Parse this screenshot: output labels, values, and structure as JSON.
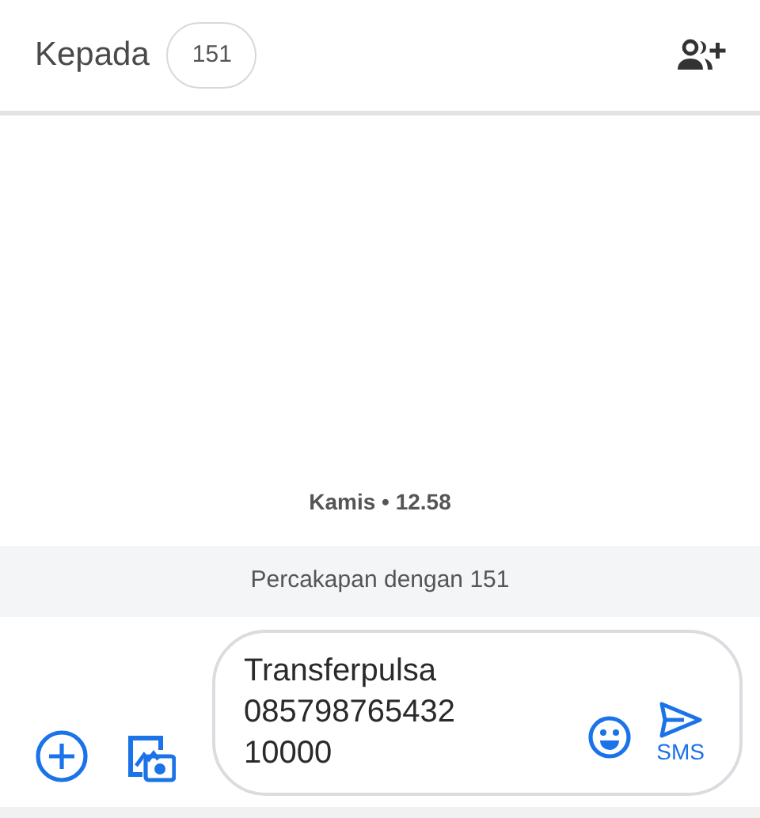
{
  "header": {
    "label": "Kepada",
    "recipient": "151"
  },
  "timestamp": "Kamis • 12.58",
  "banner": "Percakapan dengan 151",
  "composer": {
    "value": [
      "Transferpulsa",
      "085798765432",
      "10000"
    ],
    "send_label": "SMS"
  }
}
